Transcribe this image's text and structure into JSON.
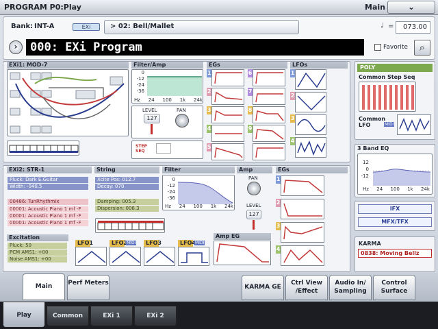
{
  "title_bar": {
    "title": "PROGRAM P0:Play",
    "mode": "Main",
    "menu_icon": "chevron-down-icon"
  },
  "header": {
    "bank_label": "Bank:",
    "bank": "INT-A",
    "exi_badge": "EXi",
    "program_select": "> 02: Bell/Mallet",
    "program_name": "000: EXi Program",
    "favorite_label": "Favorite",
    "tempo_icon": "♩",
    "tempo_eq": "=",
    "tempo": "073.00"
  },
  "exi1": {
    "label": "EXi1:",
    "model": "MOD-7",
    "filter_amp": "Filter/Amp",
    "egs": "EGs",
    "lfos": "LFOs",
    "filter_ticks": [
      "0",
      "-12",
      "-24",
      "-36"
    ],
    "freq_ticks": [
      "Hz",
      "24",
      "100",
      "1k",
      "24k"
    ],
    "level_label": "LEVEL",
    "pan_label": "PAN",
    "level_value": "127",
    "step_seq": "STEP SEQ",
    "eg_nums": [
      "1",
      "2",
      "3",
      "4",
      "5",
      "6",
      "7",
      "8",
      "9"
    ],
    "lfo_nums": [
      "1",
      "2",
      "3",
      "4"
    ]
  },
  "sidebar": {
    "poly": "POLY",
    "step_seq": "Common Step Seq",
    "common_lfo": "Common LFO",
    "midi": "MIDI",
    "eq": "3 Band EQ",
    "eq_ticks": [
      "12",
      "0",
      "-12"
    ],
    "eq_freq": [
      "Hz",
      "24",
      "100",
      "1k",
      "24k"
    ],
    "ifx": "IFX",
    "mfx": "MFX/TFX",
    "karma": "KARMA",
    "karma_value": "0838: Moving Bellz"
  },
  "exi2": {
    "label": "EXi2:",
    "model": "STR-1",
    "string": "String",
    "filter": "Filter",
    "amp": "Amp",
    "egs": "EGs",
    "fields_blue": [
      "Pluck: Dark E.Guitar",
      "Width: -040.5"
    ],
    "fields_red": [
      "00486: TunRhythmix",
      "00001: Acoustic Piano 1 mf -F",
      "00001: Acoustic Piano 1 mf -F",
      "00001: Acoustic Piano 1 mf -F"
    ],
    "string_fields_blue": [
      "Xcite Pos: 012.7",
      "Decay: 070"
    ],
    "string_fields_red": [
      "Damping: 005.3",
      "Dispersion: 006.3"
    ],
    "filter_ticks": [
      "0",
      "-12",
      "-24",
      "-36"
    ],
    "freq_ticks": [
      "Hz",
      "24",
      "100",
      "1k",
      "24k"
    ],
    "pan": "PAN",
    "level": "LEVEL",
    "level_value": "127",
    "excitation": "Excitation",
    "excite": [
      "Pluck: 50",
      "PCM AMS1: +00",
      "Noise AMS1: +00"
    ],
    "lfo_labels": [
      "LFO1",
      "LFO2",
      "LFO3",
      "LFO4"
    ],
    "midi": "MIDI",
    "amp_eg": "Amp EG",
    "eg_nums": [
      "1",
      "2",
      "3",
      "4"
    ]
  },
  "tabs": {
    "upper": [
      "Main",
      "Perf Meters",
      "KARMA GE",
      "Ctrl View /Effect",
      "Audio In/ Sampling",
      "Control Surface"
    ],
    "lower": [
      "Play",
      "Common",
      "EXi 1",
      "EXi 2"
    ]
  },
  "colors": {
    "accent_red": "#c22e2e",
    "eg_line": "#c43a3a",
    "lfo_line": "#2a3d8f",
    "poly": "#7ca84e"
  }
}
